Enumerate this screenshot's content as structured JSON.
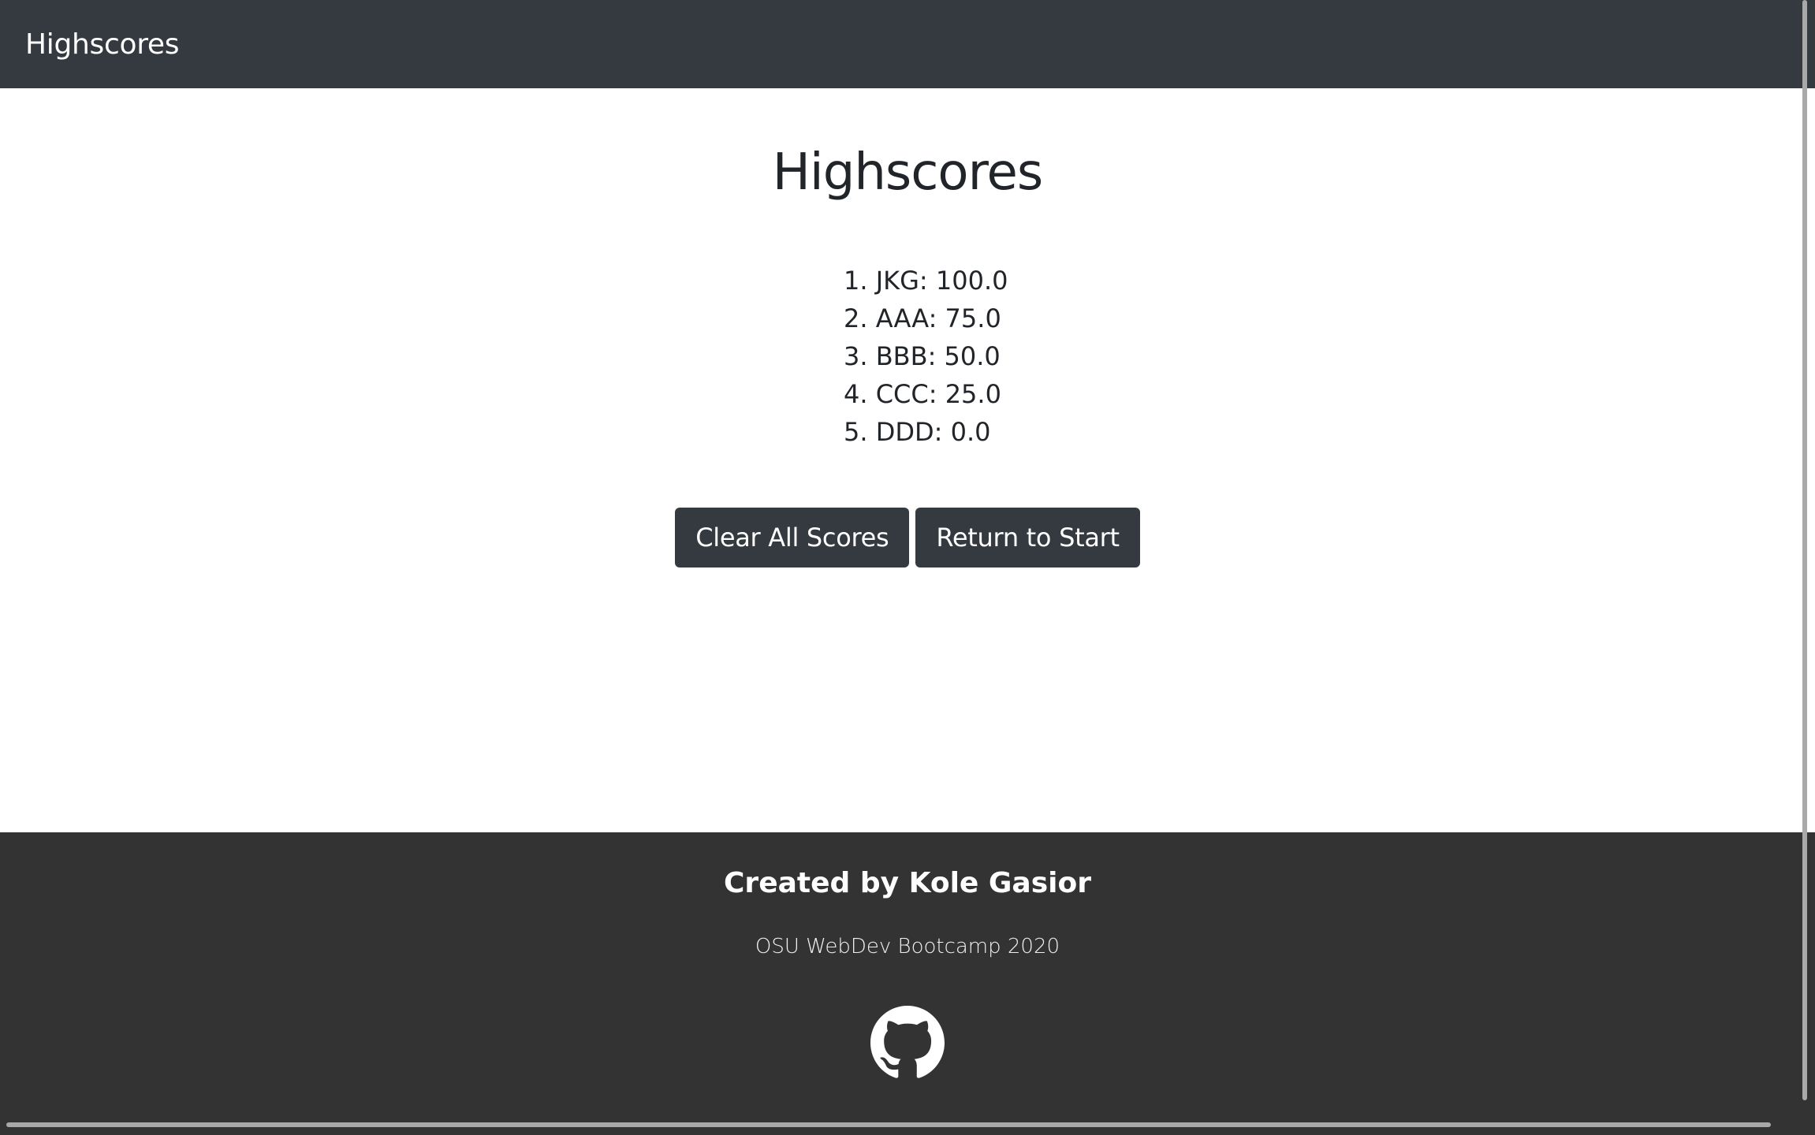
{
  "navbar": {
    "brand": "Highscores"
  },
  "main": {
    "title": "Highscores",
    "scores": [
      "1. JKG: 100.0",
      "2. AAA: 75.0",
      "3. BBB: 50.0",
      "4. CCC: 25.0",
      "5. DDD: 0.0"
    ],
    "buttons": {
      "clear_label": "Clear All Scores",
      "return_label": "Return to Start"
    }
  },
  "footer": {
    "title": "Created by Kole Gasior",
    "subtitle": "OSU WebDev Bootcamp 2020",
    "github_icon": "github-icon"
  },
  "colors": {
    "navbar_bg": "#343a40",
    "button_bg": "#343a40",
    "footer_bg": "#333333",
    "text": "#212529"
  }
}
